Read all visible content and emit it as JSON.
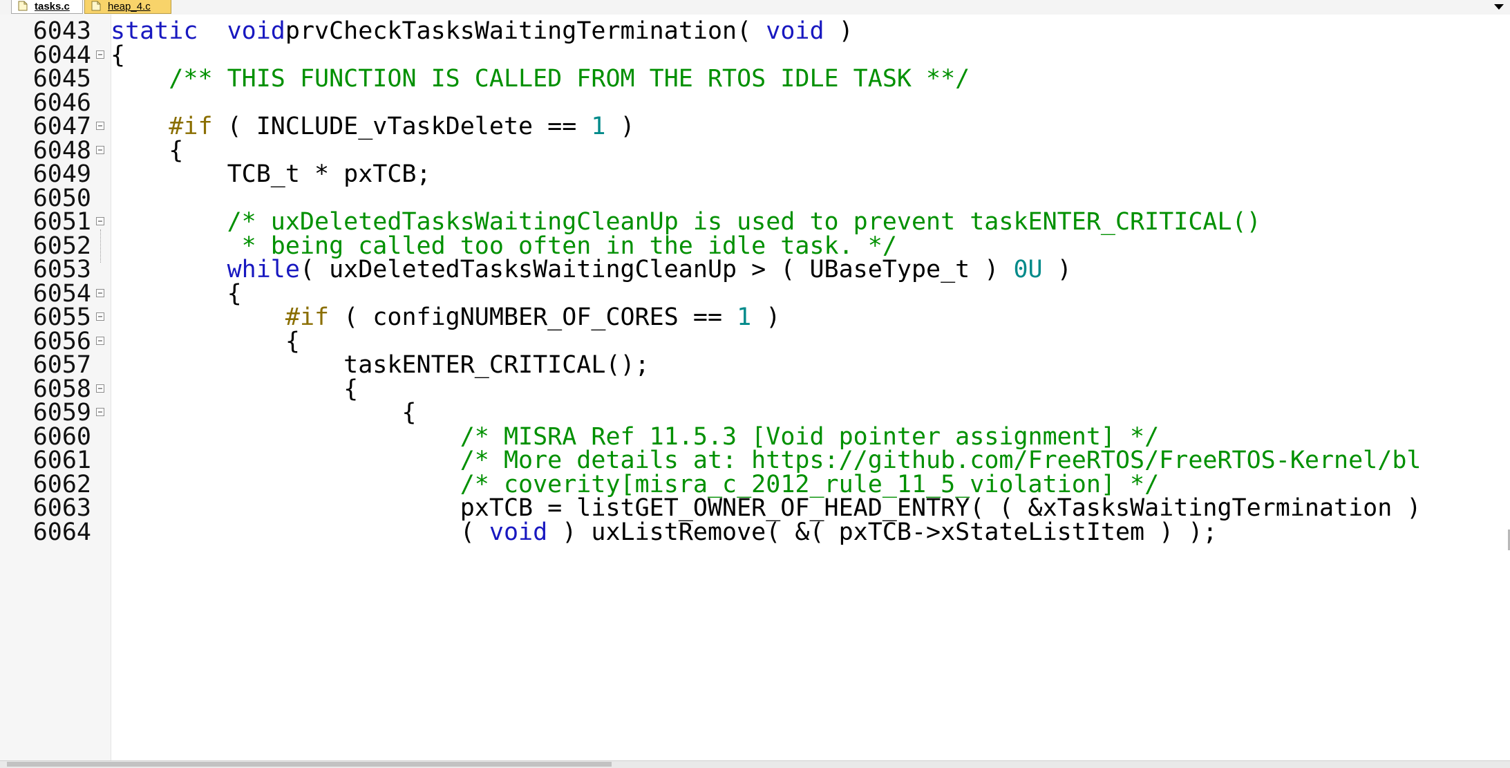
{
  "tabs": [
    {
      "label": "tasks.c",
      "active": true
    },
    {
      "label": "heap_4.c",
      "active": false
    }
  ],
  "colors": {
    "keyword": "#1818c0",
    "preprocessor": "#8a6e00",
    "comment": "#009000",
    "number": "#008a8a",
    "inactive_tab": "#f8d36a"
  },
  "lines": [
    {
      "num": "6043",
      "fold": "none",
      "tokens": [
        [
          "kw",
          "static"
        ],
        [
          "",
          "  "
        ],
        [
          "kw",
          "void"
        ],
        [
          "",
          ""
        ],
        [
          "",
          "prvCheckTasksWaitingTermination( "
        ],
        [
          "kw",
          "void"
        ],
        [
          "",
          " )"
        ]
      ]
    },
    {
      "num": "6044",
      "fold": "start",
      "tokens": [
        [
          "",
          "{"
        ]
      ]
    },
    {
      "num": "6045",
      "fold": "none",
      "tokens": [
        [
          "",
          "    "
        ],
        [
          "cm",
          "/** THIS FUNCTION IS CALLED FROM THE RTOS IDLE TASK **/"
        ]
      ]
    },
    {
      "num": "6046",
      "fold": "none",
      "tokens": []
    },
    {
      "num": "6047",
      "fold": "start",
      "tokens": [
        [
          "",
          "    "
        ],
        [
          "pp",
          "#if"
        ],
        [
          "",
          " ( INCLUDE_vTaskDelete == "
        ],
        [
          "num",
          "1"
        ],
        [
          "",
          " )"
        ]
      ]
    },
    {
      "num": "6048",
      "fold": "start",
      "tokens": [
        [
          "",
          "    {"
        ]
      ]
    },
    {
      "num": "6049",
      "fold": "none",
      "tokens": [
        [
          "",
          "        TCB_t * pxTCB;"
        ]
      ]
    },
    {
      "num": "6050",
      "fold": "none",
      "tokens": []
    },
    {
      "num": "6051",
      "fold": "start",
      "tokens": [
        [
          "",
          "        "
        ],
        [
          "cm",
          "/* uxDeletedTasksWaitingCleanUp is used to prevent taskENTER_CRITICAL()"
        ]
      ]
    },
    {
      "num": "6052",
      "fold": "cont",
      "tokens": [
        [
          "",
          "         "
        ],
        [
          "cm",
          "* being called too often in the idle task. */"
        ]
      ]
    },
    {
      "num": "6053",
      "fold": "none",
      "tokens": [
        [
          "",
          "        "
        ],
        [
          "kw",
          "while"
        ],
        [
          "",
          "( uxDeletedTasksWaitingCleanUp > ( UBaseType_t ) "
        ],
        [
          "num",
          "0U"
        ],
        [
          "",
          " )"
        ]
      ]
    },
    {
      "num": "6054",
      "fold": "start",
      "tokens": [
        [
          "",
          "        {"
        ]
      ]
    },
    {
      "num": "6055",
      "fold": "start",
      "tokens": [
        [
          "",
          "            "
        ],
        [
          "pp",
          "#if"
        ],
        [
          "",
          " ( configNUMBER_OF_CORES == "
        ],
        [
          "num",
          "1"
        ],
        [
          "",
          " )"
        ]
      ]
    },
    {
      "num": "6056",
      "fold": "start",
      "tokens": [
        [
          "",
          "            {"
        ]
      ]
    },
    {
      "num": "6057",
      "fold": "none",
      "tokens": [
        [
          "",
          "                taskENTER_CRITICAL();"
        ]
      ]
    },
    {
      "num": "6058",
      "fold": "start",
      "tokens": [
        [
          "",
          "                {"
        ]
      ]
    },
    {
      "num": "6059",
      "fold": "start",
      "tokens": [
        [
          "",
          "                    {"
        ]
      ]
    },
    {
      "num": "6060",
      "fold": "none",
      "tokens": [
        [
          "",
          "                        "
        ],
        [
          "cm",
          "/* MISRA Ref 11.5.3 [Void pointer assignment] */"
        ]
      ]
    },
    {
      "num": "6061",
      "fold": "none",
      "tokens": [
        [
          "",
          "                        "
        ],
        [
          "cm",
          "/* More details at: https://github.com/FreeRTOS/FreeRTOS-Kernel/bl"
        ]
      ]
    },
    {
      "num": "6062",
      "fold": "none",
      "tokens": [
        [
          "",
          "                        "
        ],
        [
          "cm",
          "/* coverity[misra_c_2012_rule_11_5_violation] */"
        ]
      ]
    },
    {
      "num": "6063",
      "fold": "none",
      "tokens": [
        [
          "",
          "                        pxTCB = listGET_OWNER_OF_HEAD_ENTRY( ( &xTasksWaitingTermination )"
        ]
      ]
    },
    {
      "num": "6064",
      "fold": "none",
      "tokens": [
        [
          "",
          "                        ( "
        ],
        [
          "kw",
          "void"
        ],
        [
          "",
          " ) uxListRemove( &( pxTCB->xStateListItem ) );"
        ]
      ]
    }
  ]
}
